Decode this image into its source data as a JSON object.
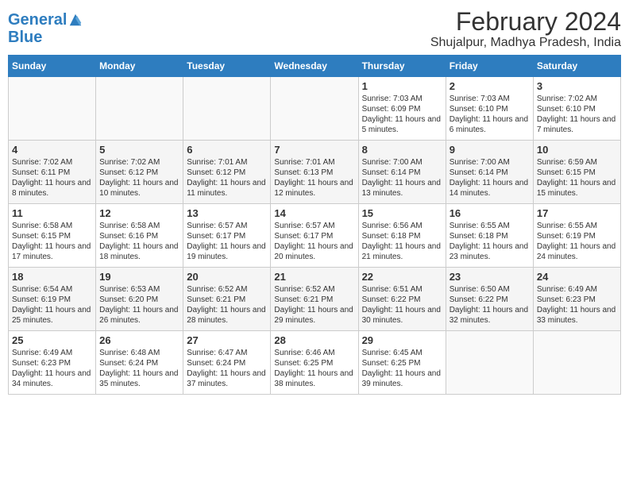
{
  "header": {
    "logo_line1": "General",
    "logo_line2": "Blue",
    "title": "February 2024",
    "subtitle": "Shujalpur, Madhya Pradesh, India"
  },
  "days_of_week": [
    "Sunday",
    "Monday",
    "Tuesday",
    "Wednesday",
    "Thursday",
    "Friday",
    "Saturday"
  ],
  "weeks": [
    [
      {
        "day": "",
        "info": ""
      },
      {
        "day": "",
        "info": ""
      },
      {
        "day": "",
        "info": ""
      },
      {
        "day": "",
        "info": ""
      },
      {
        "day": "1",
        "info": "Sunrise: 7:03 AM\nSunset: 6:09 PM\nDaylight: 11 hours and 5 minutes."
      },
      {
        "day": "2",
        "info": "Sunrise: 7:03 AM\nSunset: 6:10 PM\nDaylight: 11 hours and 6 minutes."
      },
      {
        "day": "3",
        "info": "Sunrise: 7:02 AM\nSunset: 6:10 PM\nDaylight: 11 hours and 7 minutes."
      }
    ],
    [
      {
        "day": "4",
        "info": "Sunrise: 7:02 AM\nSunset: 6:11 PM\nDaylight: 11 hours and 8 minutes."
      },
      {
        "day": "5",
        "info": "Sunrise: 7:02 AM\nSunset: 6:12 PM\nDaylight: 11 hours and 10 minutes."
      },
      {
        "day": "6",
        "info": "Sunrise: 7:01 AM\nSunset: 6:12 PM\nDaylight: 11 hours and 11 minutes."
      },
      {
        "day": "7",
        "info": "Sunrise: 7:01 AM\nSunset: 6:13 PM\nDaylight: 11 hours and 12 minutes."
      },
      {
        "day": "8",
        "info": "Sunrise: 7:00 AM\nSunset: 6:14 PM\nDaylight: 11 hours and 13 minutes."
      },
      {
        "day": "9",
        "info": "Sunrise: 7:00 AM\nSunset: 6:14 PM\nDaylight: 11 hours and 14 minutes."
      },
      {
        "day": "10",
        "info": "Sunrise: 6:59 AM\nSunset: 6:15 PM\nDaylight: 11 hours and 15 minutes."
      }
    ],
    [
      {
        "day": "11",
        "info": "Sunrise: 6:58 AM\nSunset: 6:15 PM\nDaylight: 11 hours and 17 minutes."
      },
      {
        "day": "12",
        "info": "Sunrise: 6:58 AM\nSunset: 6:16 PM\nDaylight: 11 hours and 18 minutes."
      },
      {
        "day": "13",
        "info": "Sunrise: 6:57 AM\nSunset: 6:17 PM\nDaylight: 11 hours and 19 minutes."
      },
      {
        "day": "14",
        "info": "Sunrise: 6:57 AM\nSunset: 6:17 PM\nDaylight: 11 hours and 20 minutes."
      },
      {
        "day": "15",
        "info": "Sunrise: 6:56 AM\nSunset: 6:18 PM\nDaylight: 11 hours and 21 minutes."
      },
      {
        "day": "16",
        "info": "Sunrise: 6:55 AM\nSunset: 6:18 PM\nDaylight: 11 hours and 23 minutes."
      },
      {
        "day": "17",
        "info": "Sunrise: 6:55 AM\nSunset: 6:19 PM\nDaylight: 11 hours and 24 minutes."
      }
    ],
    [
      {
        "day": "18",
        "info": "Sunrise: 6:54 AM\nSunset: 6:19 PM\nDaylight: 11 hours and 25 minutes."
      },
      {
        "day": "19",
        "info": "Sunrise: 6:53 AM\nSunset: 6:20 PM\nDaylight: 11 hours and 26 minutes."
      },
      {
        "day": "20",
        "info": "Sunrise: 6:52 AM\nSunset: 6:21 PM\nDaylight: 11 hours and 28 minutes."
      },
      {
        "day": "21",
        "info": "Sunrise: 6:52 AM\nSunset: 6:21 PM\nDaylight: 11 hours and 29 minutes."
      },
      {
        "day": "22",
        "info": "Sunrise: 6:51 AM\nSunset: 6:22 PM\nDaylight: 11 hours and 30 minutes."
      },
      {
        "day": "23",
        "info": "Sunrise: 6:50 AM\nSunset: 6:22 PM\nDaylight: 11 hours and 32 minutes."
      },
      {
        "day": "24",
        "info": "Sunrise: 6:49 AM\nSunset: 6:23 PM\nDaylight: 11 hours and 33 minutes."
      }
    ],
    [
      {
        "day": "25",
        "info": "Sunrise: 6:49 AM\nSunset: 6:23 PM\nDaylight: 11 hours and 34 minutes."
      },
      {
        "day": "26",
        "info": "Sunrise: 6:48 AM\nSunset: 6:24 PM\nDaylight: 11 hours and 35 minutes."
      },
      {
        "day": "27",
        "info": "Sunrise: 6:47 AM\nSunset: 6:24 PM\nDaylight: 11 hours and 37 minutes."
      },
      {
        "day": "28",
        "info": "Sunrise: 6:46 AM\nSunset: 6:25 PM\nDaylight: 11 hours and 38 minutes."
      },
      {
        "day": "29",
        "info": "Sunrise: 6:45 AM\nSunset: 6:25 PM\nDaylight: 11 hours and 39 minutes."
      },
      {
        "day": "",
        "info": ""
      },
      {
        "day": "",
        "info": ""
      }
    ]
  ]
}
